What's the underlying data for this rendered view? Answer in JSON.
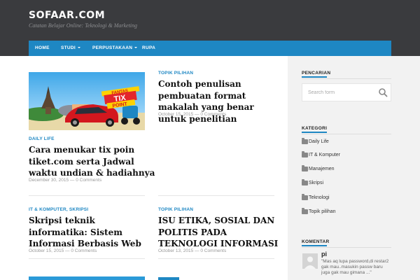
{
  "site": {
    "title": "SOFAAR.COM",
    "tagline": "Catatan Belajar Online: Teknologi & Marketing"
  },
  "nav": {
    "home": "HOME",
    "studi": "STUDI",
    "perpustakaan": "PERPUSTAKAAN",
    "rupa": "RUPA"
  },
  "posts": [
    {
      "category": "DAILY LIFE",
      "title": "Cara menukar tix poin tiket.com serta Jadwal waktu undian & hadiahnya",
      "date": "December 30, 2015",
      "comments": "0 Comments"
    },
    {
      "category": "TOPIK PILIHAN",
      "title": "Contoh penulisan pembuatan format makalah yang benar untuk penelitian",
      "date": "October 15, 2015",
      "comments": "0 Comments"
    },
    {
      "category": "IT & KOMPUTER, SKRIPSI",
      "title": "Skripsi teknik informatika: Sistem Informasi Berbasis Web",
      "date": "October 15, 2015",
      "comments": "0 Comments"
    },
    {
      "category": "TOPIK PILIHAN",
      "title": "ISU ETIKA, SOSIAL DAN POLITIS PADA TEKNOLOGI INFORMASI",
      "date": "October 13, 2015",
      "comments": "0 Comments"
    }
  ],
  "meta_separator": "—",
  "thumb": {
    "banner_line1": "FANTAS",
    "banner_line2": "TIX",
    "banner_line3": "POINT"
  },
  "sidebar": {
    "search": {
      "title": "PENCARIAN",
      "placeholder": "Search form"
    },
    "kategori": {
      "title": "KATEGORI",
      "items": [
        "Daily Life",
        "IT & Komputer",
        "Manajemen",
        "Skripsi",
        "Teknologi",
        "Topik pilihan"
      ]
    },
    "komentar": {
      "title": "KOMENTAR",
      "name": "pi",
      "text": "\"Mas aq lupa password,di restar2 gak mau..masukin passw baru juga gak mau gimana ...\""
    }
  },
  "colors": {
    "header_bg": "#3a3b3e",
    "accent": "#1e87c3"
  }
}
